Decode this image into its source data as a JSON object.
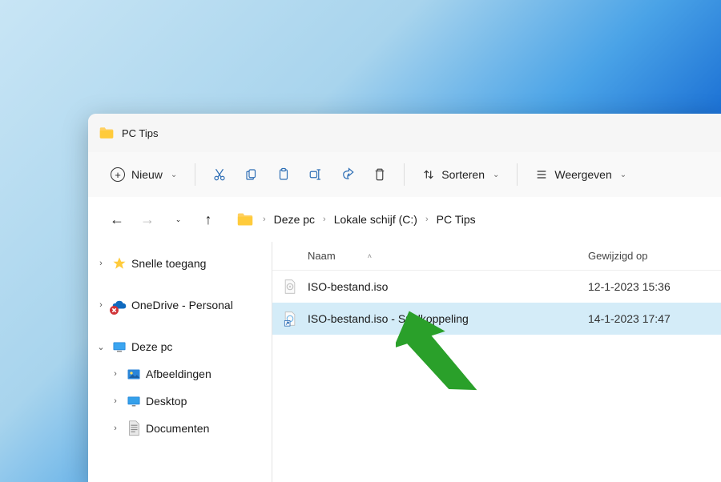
{
  "window": {
    "title": "PC Tips"
  },
  "toolbar": {
    "new_label": "Nieuw",
    "sort_label": "Sorteren",
    "view_label": "Weergeven"
  },
  "breadcrumb": {
    "items": [
      "Deze pc",
      "Lokale schijf (C:)",
      "PC Tips"
    ]
  },
  "columns": {
    "name": "Naam",
    "modified": "Gewijzigd op"
  },
  "sidebar": {
    "quick": "Snelle toegang",
    "onedrive": "OneDrive - Personal",
    "thispc": "Deze pc",
    "items": [
      {
        "label": "Afbeeldingen"
      },
      {
        "label": "Desktop"
      },
      {
        "label": "Documenten"
      }
    ]
  },
  "files": [
    {
      "name": "ISO-bestand.iso",
      "date": "12-1-2023 15:36",
      "selected": false,
      "shortcut": false
    },
    {
      "name": "ISO-bestand.iso - Snelkoppeling",
      "date": "14-1-2023 17:47",
      "selected": true,
      "shortcut": true
    }
  ]
}
